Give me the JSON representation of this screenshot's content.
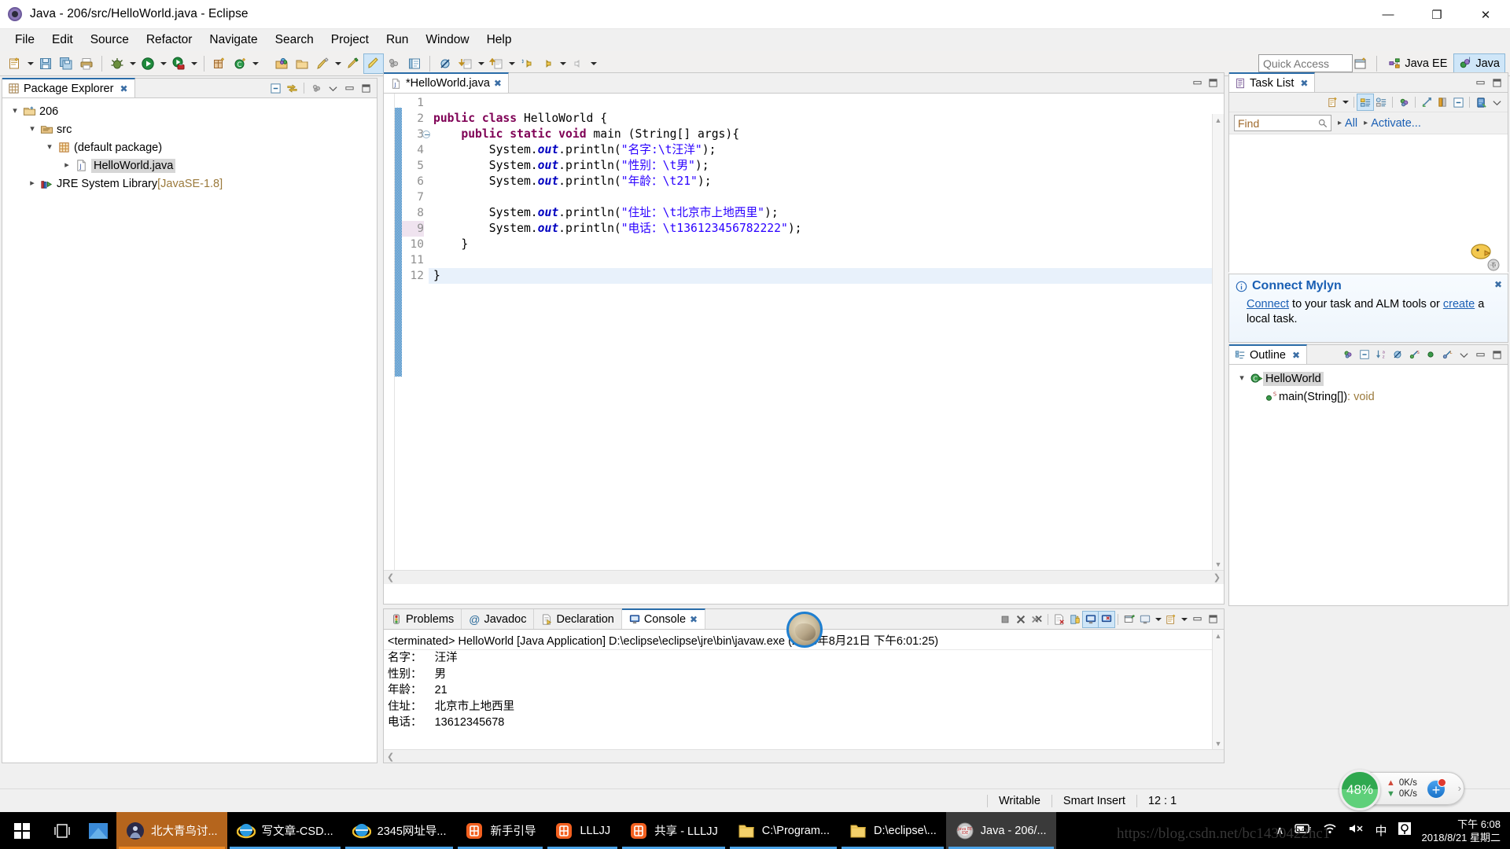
{
  "window": {
    "title": "Java - 206/src/HelloWorld.java - Eclipse",
    "app_icon": "eclipse-icon",
    "minimize": "—",
    "maximize": "❐",
    "close": "✕"
  },
  "menubar": {
    "items": [
      {
        "label": "File",
        "name": "menu-file"
      },
      {
        "label": "Edit",
        "name": "menu-edit"
      },
      {
        "label": "Source",
        "name": "menu-source"
      },
      {
        "label": "Refactor",
        "name": "menu-refactor"
      },
      {
        "label": "Navigate",
        "name": "menu-navigate"
      },
      {
        "label": "Search",
        "name": "menu-search"
      },
      {
        "label": "Project",
        "name": "menu-project"
      },
      {
        "label": "Run",
        "name": "menu-run"
      },
      {
        "label": "Window",
        "name": "menu-window"
      },
      {
        "label": "Help",
        "name": "menu-help"
      }
    ]
  },
  "toolbar": {
    "quick_access_placeholder": "Quick Access",
    "perspective_java_ee": "Java EE",
    "perspective_java": "Java",
    "icons": [
      "new-wizard-icon",
      "save-icon",
      "save-all-icon",
      "print-icon",
      "debug-icon",
      "run-icon",
      "run-external-tools-icon",
      "new-java-package-icon",
      "new-java-class-icon",
      "open-type-icon",
      "open-task-icon",
      "search-icon",
      "next-annotation-icon",
      "previous-annotation-icon",
      "last-edit-location-icon",
      "back-icon",
      "forward-icon",
      "toggle-mark-occurrences-icon",
      "pin-editor-icon",
      "link-with-editor-icon"
    ]
  },
  "package_explorer": {
    "tab_title": "Package Explorer",
    "close_glyph": "✖",
    "tools": [
      "collapse-all-icon",
      "link-with-editor-icon",
      "view-menu-icon",
      "minimize-icon",
      "maximize-icon"
    ],
    "tree": [
      {
        "label": "206",
        "icon": "java-project-icon",
        "indent": 0,
        "expanded": true,
        "selected": false,
        "sub": ""
      },
      {
        "label": "src",
        "icon": "source-folder-icon",
        "indent": 1,
        "expanded": true,
        "selected": false,
        "sub": ""
      },
      {
        "label": "(default package)",
        "icon": "package-icon",
        "indent": 2,
        "expanded": true,
        "selected": false,
        "sub": ""
      },
      {
        "label": "HelloWorld.java",
        "icon": "java-file-icon",
        "indent": 3,
        "expanded": false,
        "selected": true,
        "sub": ""
      },
      {
        "label": "JRE System Library",
        "icon": "jre-library-icon",
        "indent": 1,
        "expanded": false,
        "selected": false,
        "sub": " [JavaSE-1.8]"
      }
    ]
  },
  "editor": {
    "tab_title": "*HelloWorld.java",
    "tab_icon": "java-file-icon",
    "close_glyph": "✖",
    "current_line": 12,
    "highlighted_line": 9,
    "lines": [
      {
        "n": 1,
        "tokens": []
      },
      {
        "n": 2,
        "tokens": [
          {
            "t": "public ",
            "c": "k"
          },
          {
            "t": "class ",
            "c": "k"
          },
          {
            "t": "HelloWorld {",
            "c": "pl"
          }
        ]
      },
      {
        "n": 3,
        "fold": true,
        "tokens": [
          {
            "t": "    ",
            "c": "pl"
          },
          {
            "t": "public static void ",
            "c": "k"
          },
          {
            "t": "main (String[] args){",
            "c": "pl"
          }
        ]
      },
      {
        "n": 4,
        "tokens": [
          {
            "t": "        System.",
            "c": "pl"
          },
          {
            "t": "out",
            "c": "fl"
          },
          {
            "t": ".println(",
            "c": "pl"
          },
          {
            "t": "\"名字:\\t汪洋\"",
            "c": "s"
          },
          {
            "t": ");",
            "c": "pl"
          }
        ]
      },
      {
        "n": 5,
        "tokens": [
          {
            "t": "        System.",
            "c": "pl"
          },
          {
            "t": "out",
            "c": "fl"
          },
          {
            "t": ".println(",
            "c": "pl"
          },
          {
            "t": "\"性别：\\t男\"",
            "c": "s"
          },
          {
            "t": ");",
            "c": "pl"
          }
        ]
      },
      {
        "n": 6,
        "tokens": [
          {
            "t": "        System.",
            "c": "pl"
          },
          {
            "t": "out",
            "c": "fl"
          },
          {
            "t": ".println(",
            "c": "pl"
          },
          {
            "t": "\"年龄：\\t21\"",
            "c": "s"
          },
          {
            "t": ");",
            "c": "pl"
          }
        ]
      },
      {
        "n": 7,
        "tokens": []
      },
      {
        "n": 8,
        "tokens": [
          {
            "t": "        System.",
            "c": "pl"
          },
          {
            "t": "out",
            "c": "fl"
          },
          {
            "t": ".println(",
            "c": "pl"
          },
          {
            "t": "\"住址：\\t北京市上地西里\"",
            "c": "s"
          },
          {
            "t": ");",
            "c": "pl"
          }
        ]
      },
      {
        "n": 9,
        "tokens": [
          {
            "t": "        System.",
            "c": "pl"
          },
          {
            "t": "out",
            "c": "fl"
          },
          {
            "t": ".println(",
            "c": "pl"
          },
          {
            "t": "\"电话：\\t136123456782222\"",
            "c": "s"
          },
          {
            "t": ");",
            "c": "pl"
          }
        ]
      },
      {
        "n": 10,
        "tokens": [
          {
            "t": "    }",
            "c": "pl"
          }
        ]
      },
      {
        "n": 11,
        "tokens": []
      },
      {
        "n": 12,
        "tokens": [
          {
            "t": "}",
            "c": "pl"
          }
        ]
      }
    ]
  },
  "bottom_panel": {
    "tabs": [
      {
        "label": "Problems",
        "icon": "problems-icon",
        "active": false,
        "name": "tab-problems"
      },
      {
        "label": "Javadoc",
        "icon": "javadoc-icon",
        "active": false,
        "name": "tab-javadoc"
      },
      {
        "label": "Declaration",
        "icon": "declaration-icon",
        "active": false,
        "name": "tab-declaration"
      },
      {
        "label": "Console",
        "icon": "console-icon",
        "active": true,
        "name": "tab-console"
      }
    ],
    "close_glyph": "✖",
    "console_header": "<terminated> HelloWorld [Java Application] D:\\eclipse\\eclipse\\jre\\bin\\javaw.exe (2018年8月21日 下午6:01:25)",
    "console_output": [
      "名字：    汪洋",
      "性别：    男",
      "年龄：    21",
      "住址：    北京市上地西里",
      "电话：    13612345678"
    ],
    "tools": [
      "terminate-icon",
      "remove-launch-icon",
      "remove-all-terminated-icon",
      "clear-console-icon",
      "scroll-lock-icon",
      "show-console-on-output-icon",
      "show-console-on-error-icon",
      "pin-console-icon",
      "display-selected-console-icon",
      "open-console-icon",
      "minimize-icon",
      "maximize-icon"
    ]
  },
  "task_list": {
    "tab_title": "Task List",
    "close_glyph": "✖",
    "find_placeholder": "Find",
    "filter_all": "All",
    "activate_label": "Activate...",
    "tools": [
      "new-task-icon",
      "categorized-presentation-icon",
      "scheduled-presentation-icon",
      "focus-on-workweek-icon",
      "synchronize-changed-icon",
      "collapse-all-icon",
      "restore-tasks-icon",
      "view-menu-icon",
      "minimize-icon",
      "maximize-icon"
    ]
  },
  "mylyn": {
    "title": "Connect Mylyn",
    "info_icon": "info-icon",
    "close_glyph": "✖",
    "link_connect": "Connect",
    "text_middle": " to your task and ALM tools or ",
    "link_create": "create",
    "text_end": " a local task."
  },
  "outline": {
    "tab_title": "Outline",
    "close_glyph": "✖",
    "tools": [
      "focus-on-active-task-icon",
      "collapse-all-icon",
      "sort-icon",
      "hide-fields-icon",
      "hide-static-icon",
      "hide-nonpublic-icon",
      "hide-local-types-icon",
      "view-menu-icon",
      "minimize-icon",
      "maximize-icon"
    ],
    "tree": [
      {
        "label": "HelloWorld",
        "icon": "java-class-icon",
        "indent": 0,
        "expanded": true,
        "selected": true,
        "ret": ""
      },
      {
        "label": "main(String[])",
        "icon": "public-static-method-icon",
        "indent": 1,
        "expanded": false,
        "selected": false,
        "ret": " : void"
      }
    ]
  },
  "statusbar": {
    "writable": "Writable",
    "insert_mode": "Smart Insert",
    "position": "12 : 1"
  },
  "speed_widget": {
    "percent": "48%",
    "upload": "0K/s",
    "download": "0K/s",
    "plus_glyph": "+",
    "chevron": "›"
  },
  "taskbar": {
    "start_icon": "windows-start-icon",
    "task_view_icon": "task-view-icon",
    "items": [
      {
        "label": "北大青鸟讨...",
        "icon": "chat-app-icon",
        "accent": "#f08a24",
        "active": true,
        "bg": "#b5651d"
      },
      {
        "label": "写文章-CSD...",
        "icon": "ie-icon",
        "accent": "#4aa3e8",
        "active": false,
        "bg": "transparent"
      },
      {
        "label": "2345网址导...",
        "icon": "ie-icon",
        "accent": "#4aa3e8",
        "active": false,
        "bg": "transparent"
      },
      {
        "label": "新手引导",
        "icon": "tongue-app-icon",
        "accent": "#4aa3e8",
        "active": false,
        "bg": "transparent"
      },
      {
        "label": "LLLJJ",
        "icon": "tongue-app-icon",
        "accent": "#4aa3e8",
        "active": false,
        "bg": "transparent"
      },
      {
        "label": "共享 - LLLJJ",
        "icon": "tongue-app-icon",
        "accent": "#4aa3e8",
        "active": false,
        "bg": "transparent"
      },
      {
        "label": "C:\\Program...",
        "icon": "folder-icon",
        "accent": "#4aa3e8",
        "active": false,
        "bg": "transparent"
      },
      {
        "label": "D:\\eclipse\\...",
        "icon": "folder-icon",
        "accent": "#4aa3e8",
        "active": false,
        "bg": "transparent"
      },
      {
        "label": "Java - 206/...",
        "icon": "eclipse-icon",
        "accent": "#4aa3e8",
        "active": true,
        "bg": "#3a3a3a"
      }
    ],
    "tray": {
      "chevron": "∧",
      "battery_icon": "battery-icon",
      "network_icon": "wifi-icon",
      "volume_icon": "volume-muted-icon",
      "ime_label": "中",
      "ime_icon": "ime-icon",
      "time": "下午 6:08",
      "date": "2018/8/21 星期二"
    }
  },
  "watermark": "https://blog.csdn.net/bc1430422hc1"
}
